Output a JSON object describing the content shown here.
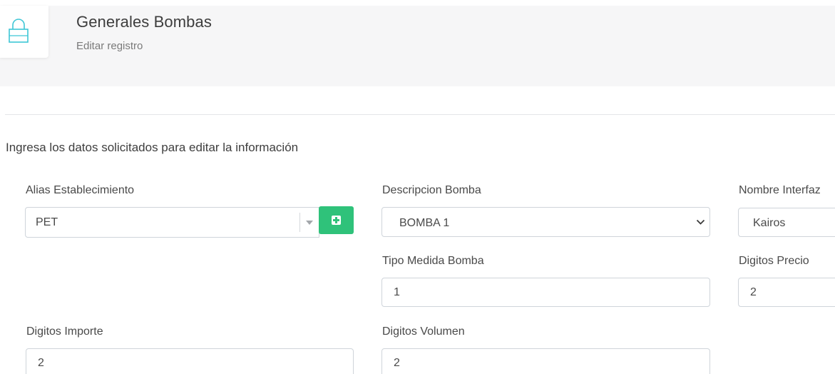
{
  "header": {
    "title": "Generales Bombas",
    "subtitle": "Editar registro",
    "icon": "lock-icon"
  },
  "form": {
    "instructions": "Ingresa los datos solicitados para editar la información",
    "alias_establecimiento": {
      "label": "Alias Establecimiento",
      "value": "PET"
    },
    "add_button_icon": "plus-square-icon",
    "descripcion_bomba": {
      "label": "Descripcion Bomba",
      "value": "BOMBA 1"
    },
    "nombre_interfaz": {
      "label": "Nombre Interfaz",
      "value": "Kairos"
    },
    "tipo_medida_bomba": {
      "label": "Tipo Medida Bomba",
      "value": "1"
    },
    "digitos_precio": {
      "label": "Digitos Precio",
      "value": "2"
    },
    "digitos_importe": {
      "label": "Digitos Importe",
      "value": "2"
    },
    "digitos_volumen": {
      "label": "Digitos Volumen",
      "value": "2"
    }
  },
  "colors": {
    "accent_icon": "#3ec6d6",
    "add_button": "#2fc27a",
    "header_band": "#f6f6f7"
  }
}
